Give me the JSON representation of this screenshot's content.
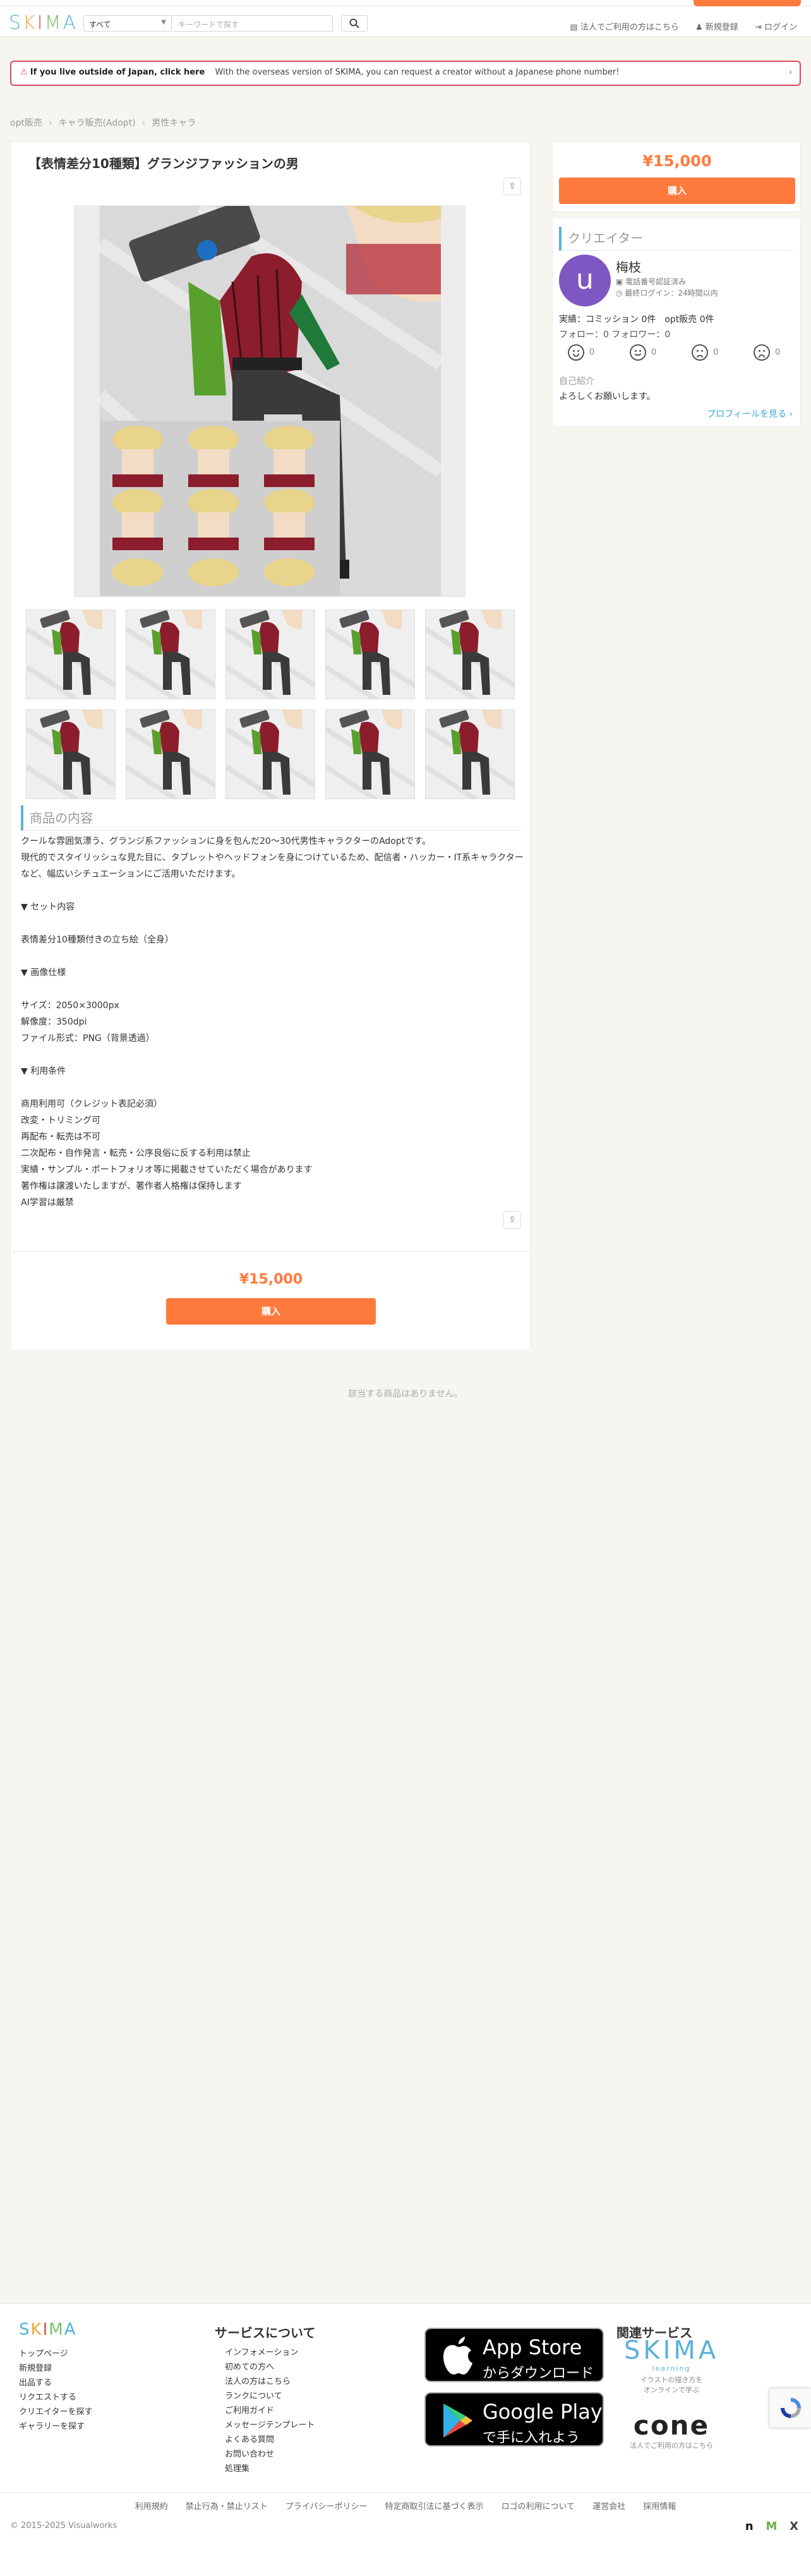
{
  "header": {
    "logo_letters": [
      {
        "ch": "S",
        "color": "#4fb3d9"
      },
      {
        "ch": "K",
        "color": "#f2a83a"
      },
      {
        "ch": "I",
        "color": "#d9534f"
      },
      {
        "ch": "M",
        "color": "#7ac36a"
      },
      {
        "ch": "A",
        "color": "#4fb3d9"
      }
    ],
    "category": "すべて",
    "search_placeholder": "キーワードで探す",
    "corporate_link": "法人でご利用の方はこちら",
    "register_link": "新規登録",
    "login_link": "ログイン"
  },
  "notice": {
    "bold": "If you live outside of Japan, click here",
    "text": "With the overseas version of SKIMA, you can request a creator without a Japanese phone number!"
  },
  "breadcrumb": [
    "opt販売",
    "キャラ販売(Adopt)",
    "男性キャラ"
  ],
  "product": {
    "title": "【表情差分10種類】グランジファッションの男",
    "price": "¥15,000",
    "buy_label": "購入",
    "thumbnail_count": 10,
    "section_heading": "商品の内容",
    "description": [
      "クールな雰囲気漂う、グランジ系ファッションに身を包んだ20〜30代男性キャラクターのAdoptです。",
      "現代的でスタイリッシュな見た目に、タブレットやヘッドフォンを身につけているため、配信者・ハッカー・IT系キャラクターなど、幅広いシチュエーションにご活用いただけます。",
      "",
      "▼ セット内容",
      "",
      "表情差分10種類付きの立ち絵（全身）",
      "",
      "▼ 画像仕様",
      "",
      "サイズ：2050×3000px",
      "解像度：350dpi",
      "ファイル形式：PNG（背景透過）",
      "",
      "▼ 利用条件",
      "",
      "商用利用可（クレジット表記必須）",
      "改変・トリミング可",
      "再配布・転売は不可",
      "二次配布・自作発言・転売・公序良俗に反する利用は禁止",
      "実績・サンプル・ポートフォリオ等に掲載させていただく場合があります",
      "著作権は譲渡いたしますが、著作者人格権は保持します",
      "AI学習は厳禁"
    ]
  },
  "creator": {
    "heading": "クリエイター",
    "avatar_letter": "u",
    "name": "梅枝",
    "badge": "電話番号認証済み",
    "last_login": "最終ログイン：24時間以内",
    "stats": "実績：コミッション 0件　opt販売 0件",
    "follow": "フォロー：0 フォロワー：0",
    "ratings": [
      "0",
      "0",
      "0",
      "0"
    ],
    "intro_heading": "自己紹介",
    "intro_text": "よろしくお願いします。",
    "profile_link": "プロフィールを見る ›"
  },
  "related": {
    "empty_text": "該当する商品はありません。"
  },
  "footer": {
    "col1": [
      "トップページ",
      "新規登録",
      "出品する",
      "リクエストする",
      "クリエイターを探す",
      "ギャラリーを探す"
    ],
    "about_heading": "サービスについて",
    "col2": [
      "インフォメーション",
      "初めての方へ",
      "法人の方はこちら",
      "ランクについて",
      "ご利用ガイド",
      "メッセージテンプレート",
      "よくある質問",
      "お問い合わせ",
      "処理集"
    ],
    "appstore_big": "App Store",
    "appstore_small": "からダウンロード",
    "gplay_big": "Google Play",
    "gplay_small": "で手に入れよう",
    "related_heading": "関連サービス",
    "skima_learning_title": "SKIMA",
    "skima_learning_sub": "learning",
    "skima_learning_desc": "イラストの描き方を\nオンラインで学ぶ",
    "cone_title": "cone",
    "cone_desc": "法人でご利用の方はこちら",
    "links": [
      "利用規約",
      "禁止行為・禁止リスト",
      "プライバシーポリシー",
      "特定商取引法に基づく表示",
      "ロゴの利用について",
      "運営会社",
      "採用情報"
    ],
    "copyright": "© 2015-2025 Visualworks",
    "social": [
      "n",
      "M",
      "X"
    ]
  }
}
